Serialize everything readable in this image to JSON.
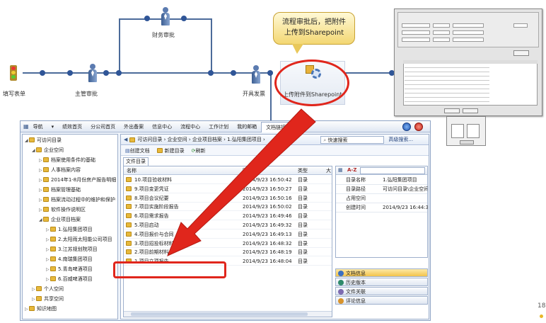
{
  "flow": {
    "nodes": [
      "填写表单",
      "主管审批",
      "财务审批",
      "开具发票",
      "上传附件到Sharepoint"
    ],
    "callout": [
      "流程审批后，把附件",
      "上传到Sharepoint"
    ]
  },
  "menu": [
    "导航",
    "▾",
    "绩效首页",
    "分公司首页",
    "外出备案",
    "信息中心",
    "流程中心",
    "工作计划",
    "我的邮箱",
    "文档链接"
  ],
  "tree": [
    {
      "label": "可访问目录",
      "indent": 0,
      "expander": "◢"
    },
    {
      "label": "企业空间",
      "indent": 1,
      "expander": "◢"
    },
    {
      "label": "档案使用条件的基础",
      "indent": 2,
      "expander": "▷"
    },
    {
      "label": "人事档案内容",
      "indent": 2,
      "expander": "▷"
    },
    {
      "label": "2014年1-8月份房产报告明细",
      "indent": 2,
      "expander": "▷"
    },
    {
      "label": "档案管理基础",
      "indent": 2,
      "expander": "▷"
    },
    {
      "label": "档案流动过程中的维护和保护",
      "indent": 2,
      "expander": "▷"
    },
    {
      "label": "软件操作说明区",
      "indent": 2,
      "expander": "▷"
    },
    {
      "label": "企业项目档案",
      "indent": 2,
      "expander": "◢"
    },
    {
      "label": "1.弘阳集团项目",
      "indent": 3,
      "expander": "▷"
    },
    {
      "label": "2.太阳雨太阳能公司项目",
      "indent": 3,
      "expander": "▷"
    },
    {
      "label": "3.江苏规划院项目",
      "indent": 3,
      "expander": "▷"
    },
    {
      "label": "4.南瑞集团项目",
      "indent": 3,
      "expander": "▷"
    },
    {
      "label": "5.青岛啤酒项目",
      "indent": 3,
      "expander": "▷"
    },
    {
      "label": "6.百威啤酒项目",
      "indent": 3,
      "expander": "▷"
    },
    {
      "label": "个人空间",
      "indent": 1,
      "expander": "▷"
    },
    {
      "label": "共享空间",
      "indent": 1,
      "expander": "▷"
    },
    {
      "label": "知识地图",
      "indent": 0,
      "expander": "▷"
    }
  ],
  "breadcrumb": "可访问目录 › 企业空间 › 企业项目档案 › 1.弘阳集团项目 ›",
  "search_label": "快速搜索",
  "advanced_search": "高级搜索...",
  "toolbar": {
    "create_doc": "创建文档",
    "create_dir": "新建目录",
    "refresh": "刷新"
  },
  "tab_label": "文件目录",
  "columns": {
    "name": "名称",
    "time": "时间",
    "type": "类型",
    "size": "大"
  },
  "rows": [
    {
      "name": "10.项目验收材料",
      "time": "2014/9/23 16:50:42",
      "type": "目录"
    },
    {
      "name": "9.项目变更凭证",
      "time": "2014/9/23 16:50:27",
      "type": "目录"
    },
    {
      "name": "8.项目会议纪要",
      "time": "2014/9/23 16:50:16",
      "type": "目录"
    },
    {
      "name": "7.项目实施阶段报告",
      "time": "2014/9/23 16:50:02",
      "type": "目录"
    },
    {
      "name": "6.项目需求报告",
      "time": "2014/9/23 16:49:46",
      "type": "目录"
    },
    {
      "name": "5.项目启动",
      "time": "2014/9/23 16:49:32",
      "type": "目录"
    },
    {
      "name": "4.项目报价与合同",
      "time": "2014/9/23 16:49:13",
      "type": "目录"
    },
    {
      "name": "3.项目招投标材料",
      "time": "2014/9/23 16:48:32",
      "type": "目录"
    },
    {
      "name": "2.项目前期材料",
      "time": "2014/9/23 16:48:19",
      "type": "目录"
    },
    {
      "name": "1.项目立项报告",
      "time": "2014/9/23 16:48:04",
      "type": "目录"
    }
  ],
  "props_sort": "A-Z",
  "props": [
    {
      "k": "目录名称",
      "v": "1.弘阳集团项目"
    },
    {
      "k": "目录路径",
      "v": "可访问目录\\企业空间\\"
    },
    {
      "k": "占用空间",
      "v": ""
    },
    {
      "k": "创建时间",
      "v": "2014/9/23 16:44:36"
    }
  ],
  "side_buttons": [
    "文档信息",
    "历史版本",
    "文件关联",
    "评论信息"
  ],
  "page_number": "18",
  "colors": {
    "highlight": "#e0261c",
    "arrow": "#e0261c",
    "accent": "#2f5597"
  }
}
